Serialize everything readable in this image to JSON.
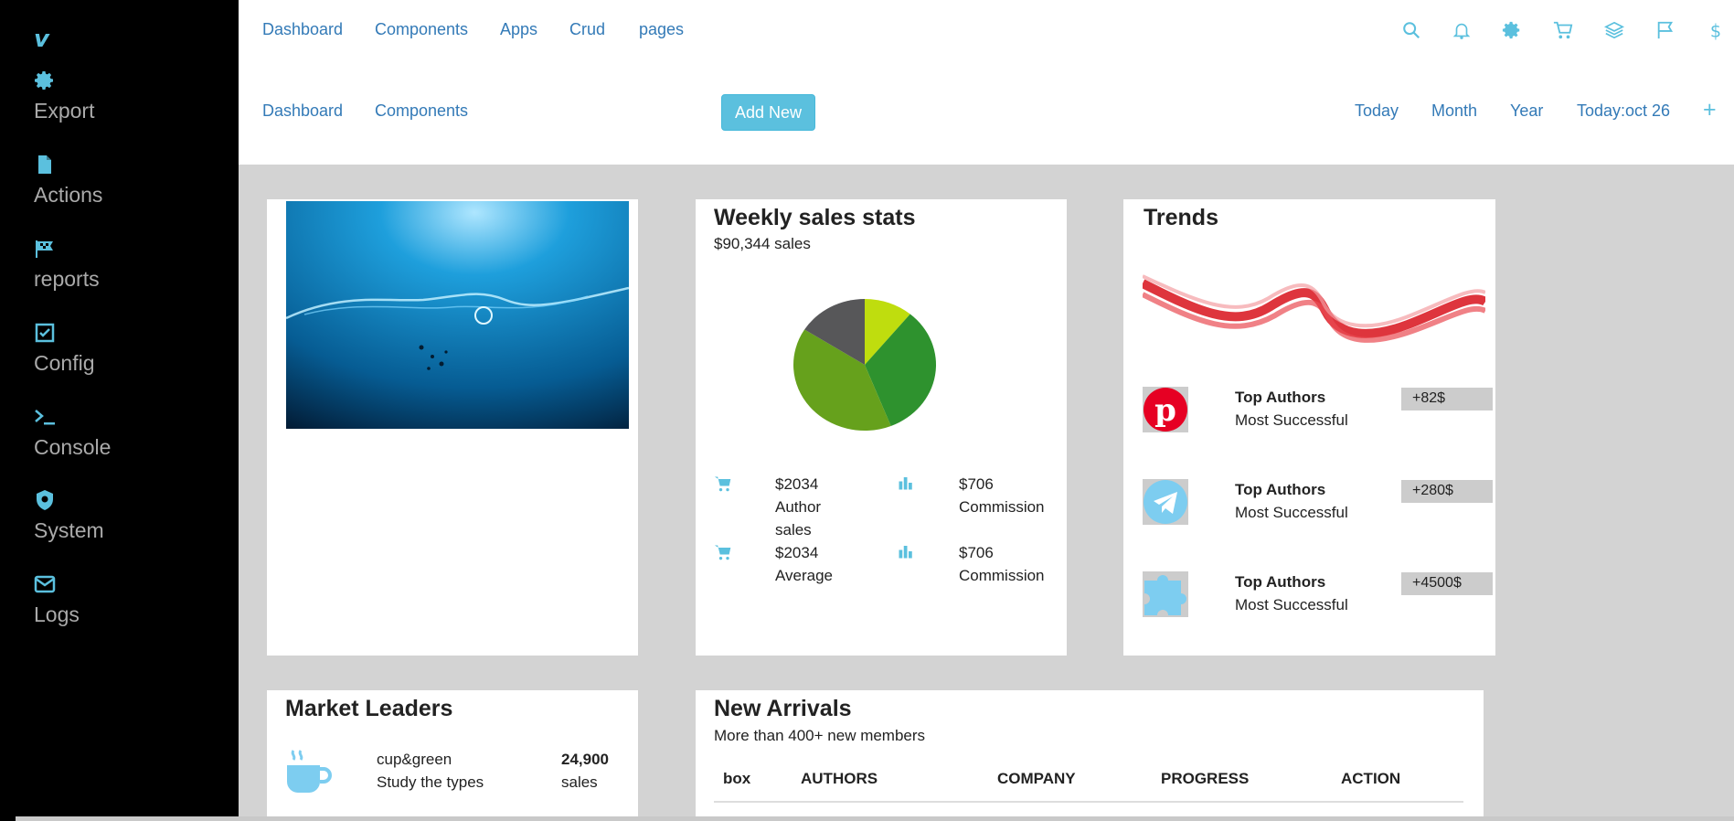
{
  "sidebar": {
    "logo": "v",
    "items": [
      {
        "label": "Export",
        "icon": "gear-icon"
      },
      {
        "label": "Actions",
        "icon": "file-icon"
      },
      {
        "label": "reports",
        "icon": "flag-icon"
      },
      {
        "label": "Config",
        "icon": "checkbox-icon"
      },
      {
        "label": "Console",
        "icon": "terminal-icon"
      },
      {
        "label": "System",
        "icon": "shield-icon"
      },
      {
        "label": "Logs",
        "icon": "envelope-icon"
      }
    ]
  },
  "topnav": {
    "links": [
      "Dashboard",
      "Components",
      "Apps",
      "Crud",
      "pages"
    ],
    "icons": [
      "search-icon",
      "bell-icon",
      "gear-icon",
      "cart-icon",
      "layers-icon",
      "flag-icon",
      "dollar-icon"
    ]
  },
  "subnav": {
    "links": [
      "Dashboard",
      "Components"
    ],
    "add_button": "Add New",
    "filters": [
      "Today",
      "Month",
      "Year",
      "Today:oct 26"
    ],
    "plus": "+"
  },
  "weekly": {
    "title": "Weekly sales stats",
    "subtitle": "$90,344 sales",
    "stats": [
      {
        "value": "$2034",
        "label": "Author sales",
        "icon": "cart-icon"
      },
      {
        "value": "$706",
        "label": "Commission",
        "icon": "bar-chart-icon"
      },
      {
        "value": "$2034",
        "label": "Average",
        "icon": "cart-icon"
      },
      {
        "value": "$706",
        "label": "Commission",
        "icon": "bar-chart-icon"
      }
    ],
    "pie_colors": [
      "#bfdd0e",
      "#2e922e",
      "#66a11c",
      "#575759"
    ]
  },
  "trends": {
    "title": "Trends",
    "authors": [
      {
        "name": "Top Authors",
        "desc": "Most Successful",
        "badge": "+82$",
        "icon": "pinterest-icon"
      },
      {
        "name": "Top Authors",
        "desc": "Most Successful",
        "badge": "+280$",
        "icon": "telegram-icon"
      },
      {
        "name": "Top Authors",
        "desc": "Most Successful",
        "badge": "+4500$",
        "icon": "puzzle-icon"
      }
    ]
  },
  "market": {
    "title": "Market Leaders",
    "item": {
      "name": "cup&green",
      "desc": "Study the types",
      "value": "24,900",
      "unit": "sales",
      "icon": "coffee-cup-icon"
    }
  },
  "arrivals": {
    "title": "New Arrivals",
    "subtitle": "More than 400+ new members",
    "columns": [
      "box",
      "AUTHORS",
      "COMPANY",
      "PROGRESS",
      "ACTION"
    ]
  },
  "colors": {
    "accent": "#5bc0de",
    "link": "#337ab7",
    "sidebar": "#000000",
    "background": "#d3d3d3"
  }
}
